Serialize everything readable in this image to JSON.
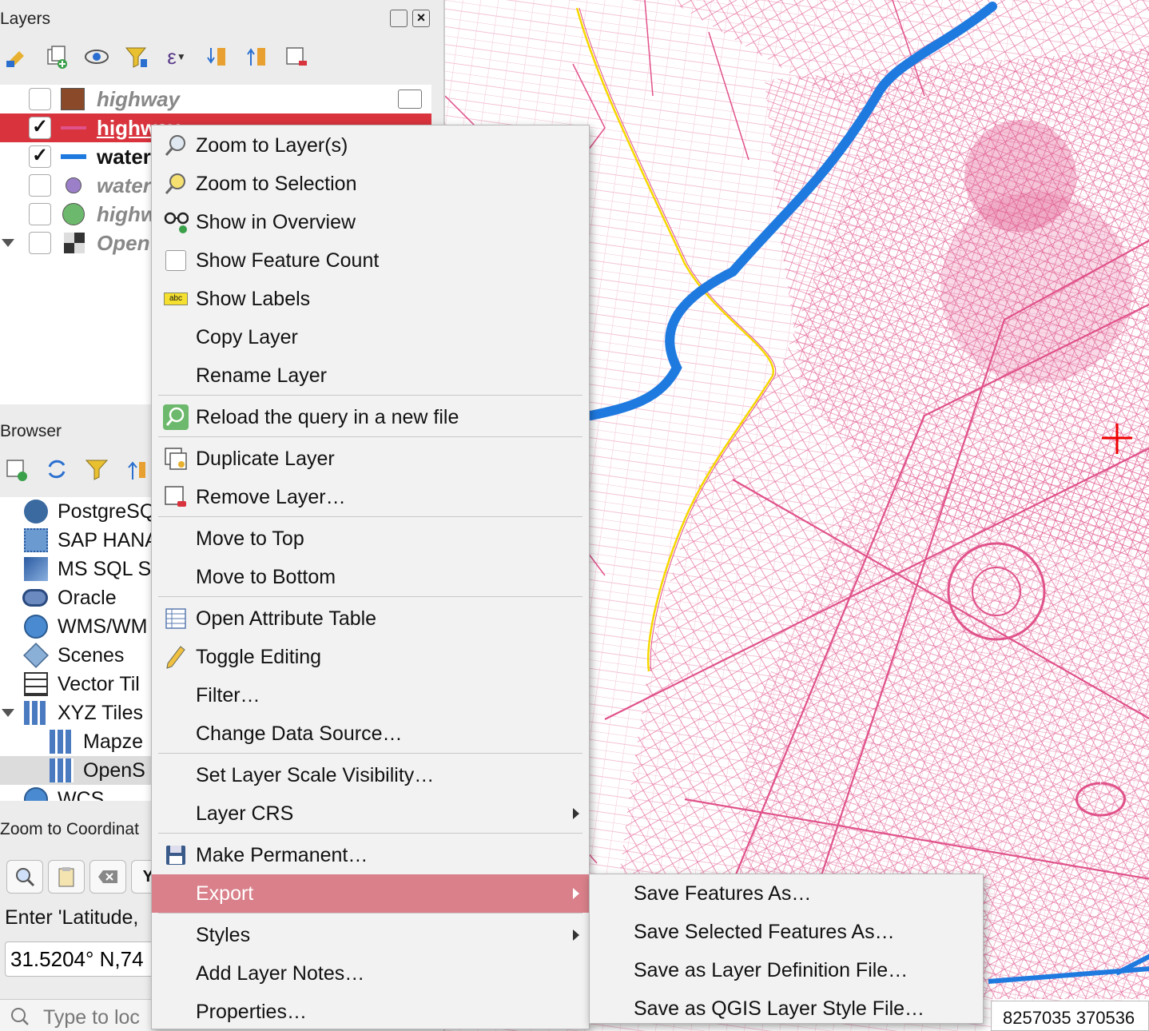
{
  "layers_panel": {
    "title": "Layers",
    "toolbar_icons": [
      "style-brush-icon",
      "add-group-icon",
      "visibility-eye-icon",
      "filter-legend-icon",
      "expression-filter-icon",
      "expand-all-icon",
      "collapse-all-icon",
      "remove-layer-icon"
    ],
    "items": [
      {
        "name": "highway",
        "checked": false,
        "symbol": "brown-square",
        "selected": false
      },
      {
        "name": "highway",
        "checked": true,
        "symbol": "pink-line",
        "selected": true
      },
      {
        "name": "water",
        "checked": true,
        "symbol": "blue-line",
        "selected": false
      },
      {
        "name": "water",
        "checked": false,
        "symbol": "purple-dot",
        "selected": false
      },
      {
        "name": "highw",
        "checked": false,
        "symbol": "green-dot",
        "selected": false
      },
      {
        "name": "Open",
        "checked": false,
        "symbol": "checker",
        "selected": false
      }
    ],
    "check_mark": "✓"
  },
  "browser_panel": {
    "title": "Browser",
    "items": [
      {
        "label": "PostgreSQ",
        "icon": "postgres-elephant-icon"
      },
      {
        "label": "SAP HANA",
        "icon": "sap-hana-icon"
      },
      {
        "label": "MS SQL S",
        "icon": "mssql-icon"
      },
      {
        "label": "Oracle",
        "icon": "oracle-icon"
      },
      {
        "label": "WMS/WM",
        "icon": "wms-globe-icon"
      },
      {
        "label": "Scenes",
        "icon": "scenes-cube-icon"
      },
      {
        "label": "Vector Til",
        "icon": "vector-tiles-icon"
      },
      {
        "label": "XYZ Tiles",
        "icon": "xyz-tiles-icon"
      },
      {
        "label": "Mapze",
        "icon": "xyz-tiles-icon"
      },
      {
        "label": "OpenS",
        "icon": "xyz-tiles-icon"
      },
      {
        "label": "WCS",
        "icon": "wcs-globe-icon"
      }
    ]
  },
  "zoom_panel": {
    "title": "Zoom to Coordinat",
    "button_y_label": "Y,",
    "instruction": "Enter 'Latitude,",
    "coordinate_value": "31.5204° N,74"
  },
  "locator": {
    "placeholder": "Type to loc"
  },
  "status": {
    "coordinates": "8257035  370536"
  },
  "context_menu": {
    "items": [
      {
        "label": "Zoom to Layer(s)",
        "icon": "zoom-layer-icon"
      },
      {
        "label": "Zoom to Selection",
        "icon": "zoom-selection-icon"
      },
      {
        "label": "Show in Overview",
        "icon": "overview-glasses-icon"
      },
      {
        "label": "Show Feature Count",
        "icon": "checkbox-icon"
      },
      {
        "label": "Show Labels",
        "icon": "labels-abc-icon"
      },
      {
        "label": "Copy Layer",
        "icon": ""
      },
      {
        "label": "Rename Layer",
        "icon": ""
      },
      {
        "label": "Reload the query in a new file",
        "icon": "reload-query-icon"
      },
      {
        "label": "Duplicate Layer",
        "icon": "duplicate-layer-icon"
      },
      {
        "label": "Remove Layer…",
        "icon": "remove-layer-icon"
      },
      {
        "label": "Move to Top",
        "icon": ""
      },
      {
        "label": "Move to Bottom",
        "icon": ""
      },
      {
        "label": "Open Attribute Table",
        "icon": "attribute-table-icon"
      },
      {
        "label": "Toggle Editing",
        "icon": "pencil-icon"
      },
      {
        "label": "Filter…",
        "icon": ""
      },
      {
        "label": "Change Data Source…",
        "icon": ""
      },
      {
        "label": "Set Layer Scale Visibility…",
        "icon": ""
      },
      {
        "label": "Layer CRS",
        "icon": "",
        "submenu": true
      },
      {
        "label": "Make Permanent…",
        "icon": "save-disk-icon"
      },
      {
        "label": "Export",
        "icon": "",
        "submenu": true,
        "highlighted": true
      },
      {
        "label": "Styles",
        "icon": "",
        "submenu": true
      },
      {
        "label": "Add Layer Notes…",
        "icon": ""
      },
      {
        "label": "Properties…",
        "icon": ""
      }
    ]
  },
  "export_submenu": {
    "items": [
      "Save Features As…",
      "Save Selected Features As…",
      "Save as Layer Definition File…",
      "Save as QGIS Layer Style File…"
    ]
  },
  "colors": {
    "roads": "#e0528a",
    "water": "#1f7ae0",
    "selection": "#d9333d",
    "menu_highlight": "#d9808a"
  }
}
